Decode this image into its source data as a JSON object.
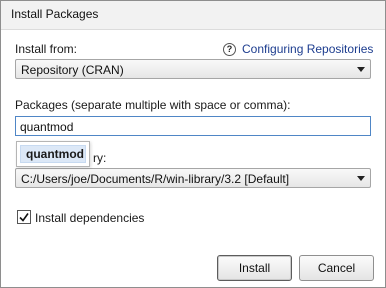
{
  "window": {
    "title": "Install Packages"
  },
  "install_from": {
    "label": "Install from:",
    "help_link": "Configuring Repositories",
    "selected": "Repository (CRAN)"
  },
  "packages": {
    "label": "Packages (separate multiple with space or comma):",
    "value": "quantmod",
    "suggestion": "quantmod"
  },
  "library": {
    "label_visible": "ry:",
    "selected": "C:/Users/joe/Documents/R/win-library/3.2 [Default]"
  },
  "dependencies": {
    "label": "Install dependencies",
    "checked": true
  },
  "buttons": {
    "install": "Install",
    "cancel": "Cancel"
  },
  "icons": {
    "help": "?"
  }
}
